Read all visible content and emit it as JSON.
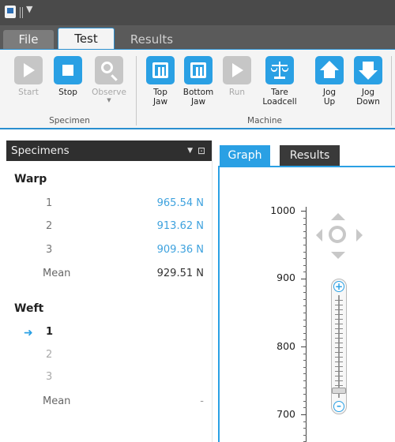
{
  "colors": {
    "accent": "#2aa0e4",
    "dark_header": "#2f2f2f",
    "value_blue": "#3ea2de"
  },
  "menu_tabs": {
    "file": "File",
    "test": "Test",
    "results": "Results"
  },
  "ribbon": {
    "specimen_group": {
      "label": "Specimen",
      "buttons": [
        {
          "label": "Start",
          "icon": "play-icon",
          "enabled": false
        },
        {
          "label": "Stop",
          "icon": "stop-icon",
          "enabled": true
        },
        {
          "label": "Observe",
          "icon": "magnifier-icon",
          "enabled": false
        }
      ]
    },
    "machine_group": {
      "label": "Machine",
      "buttons": [
        {
          "label": "Top\nJaw",
          "icon": "top-jaw-icon",
          "enabled": true
        },
        {
          "label": "Bottom\nJaw",
          "icon": "bottom-jaw-icon",
          "enabled": true
        },
        {
          "label": "Run",
          "icon": "play-icon",
          "enabled": false
        },
        {
          "label": "Tare\nLoadcell",
          "icon": "scale-icon",
          "enabled": true
        },
        {
          "label": "Jog\nUp",
          "icon": "arrow-up-icon",
          "enabled": true
        },
        {
          "label": "Jog\nDown",
          "icon": "arrow-down-icon",
          "enabled": true
        }
      ]
    }
  },
  "specimens": {
    "title": "Specimens",
    "groups": [
      {
        "name": "Warp",
        "rows": [
          {
            "num": "1",
            "value": "965.54 N"
          },
          {
            "num": "2",
            "value": "913.62 N"
          },
          {
            "num": "3",
            "value": "909.36 N"
          }
        ],
        "mean_label": "Mean",
        "mean_value": "929.51 N"
      },
      {
        "name": "Weft",
        "rows": [
          {
            "num": "1",
            "value": "",
            "selected": true
          },
          {
            "num": "2",
            "value": ""
          },
          {
            "num": "3",
            "value": ""
          }
        ],
        "mean_label": "Mean",
        "mean_value": "-"
      }
    ]
  },
  "graph_tabs": {
    "graph": "Graph",
    "results": "Results"
  },
  "graph": {
    "y_ticks": [
      "1000",
      "900",
      "800",
      "700"
    ]
  }
}
